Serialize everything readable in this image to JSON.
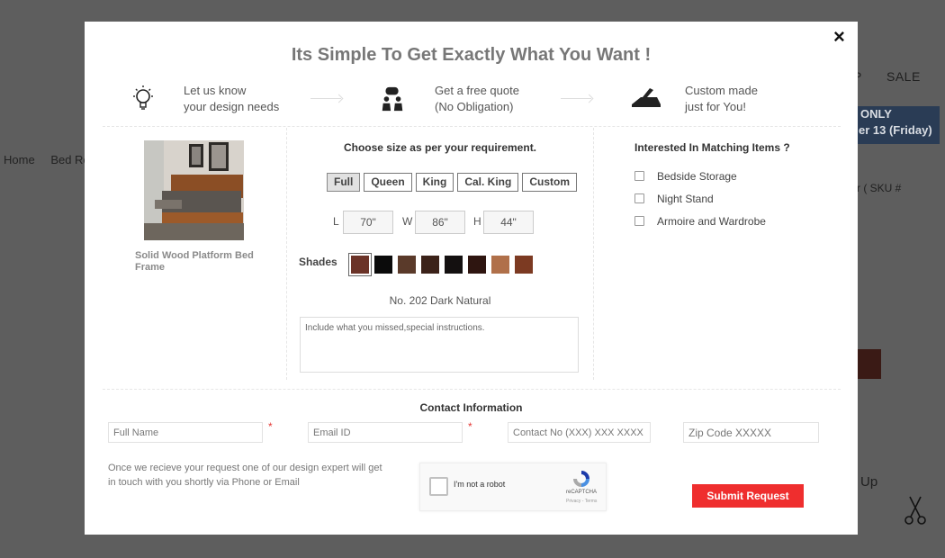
{
  "background": {
    "breadcrumb": [
      "Home",
      "Bed Roo"
    ],
    "bag_tip": "P",
    "sale": "SALE",
    "promo": [
      "ONLY",
      "er 13 (Friday)"
    ],
    "sku": "r ( SKU #",
    "side_text": "Up"
  },
  "modal": {
    "close": "×",
    "title": "Its Simple To Get Exactly What You Want !",
    "steps": [
      {
        "icon": "lightbulb-icon",
        "line1": "Let us know",
        "line2": "your design needs"
      },
      {
        "icon": "consultation-icon",
        "line1": "Get a free quote",
        "line2": "(No Obligation)"
      },
      {
        "icon": "woodworking-plane-icon",
        "line1": "Custom made",
        "line2": "just for You!"
      }
    ],
    "product": {
      "name": "Solid Wood Platform Bed Frame"
    },
    "size": {
      "heading": "Choose size as per your requirement.",
      "options": [
        "Full",
        "Queen",
        "King",
        "Cal. King",
        "Custom"
      ],
      "selected": "Full",
      "dimensions": [
        {
          "label": "L",
          "value": "70\""
        },
        {
          "label": "W",
          "value": "86\""
        },
        {
          "label": "H",
          "value": "44\""
        }
      ]
    },
    "shades": {
      "label": "Shades",
      "colors": [
        "#6b3328",
        "#0b0b0b",
        "#5a3a2a",
        "#3b2219",
        "#141010",
        "#2e1510",
        "#b0704a",
        "#7c3a22"
      ],
      "selected_index": 0,
      "selected_name": "No. 202 Dark Natural"
    },
    "notes": {
      "placeholder": "Include what you missed,special instructions."
    },
    "matching": {
      "heading": "Interested In Matching Items ?",
      "items": [
        "Bedside Storage",
        "Night Stand",
        "Armoire and Wardrobe"
      ]
    },
    "contact": {
      "heading": "Contact Information",
      "full_name": "Full Name",
      "email": "Email ID",
      "phone": "Contact No (XXX) XXX XXXX",
      "zip": "Zip Code XXXXX",
      "required_mark": "*"
    },
    "notice": "Once we recieve your request one of our design expert will get in touch with you shortly via Phone or Email",
    "captcha": {
      "label": "I'm not a robot",
      "brand": "reCAPTCHA",
      "terms": "Privacy - Terms"
    },
    "submit": "Submit Request"
  }
}
